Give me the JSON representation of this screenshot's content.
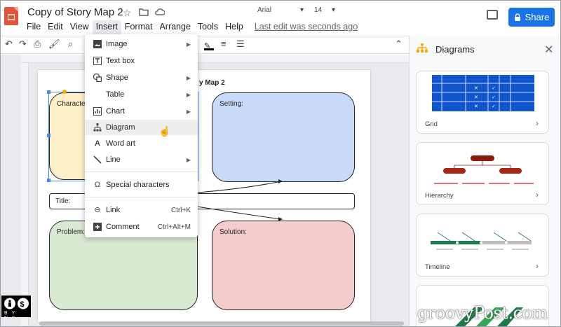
{
  "app": {
    "title": "Copy of Story Map 2",
    "last_edit": "Last edit was seconds ago",
    "share_label": "Share"
  },
  "menubar": [
    "File",
    "Edit",
    "View",
    "Insert",
    "Format",
    "Arrange",
    "Tools",
    "Help"
  ],
  "toolbar": {
    "font": "Arial",
    "size": "14"
  },
  "canvas": {
    "page_title": "y Map 2",
    "boxes": {
      "character": "Character",
      "setting": "Setting:",
      "title": "Title:",
      "problem": "Problem:",
      "solution": "Solution:"
    }
  },
  "insert_menu": {
    "items": [
      {
        "label": "Image",
        "icon": "image-icon",
        "submenu": true
      },
      {
        "label": "Text box",
        "icon": "text-box-icon"
      },
      {
        "label": "Shape",
        "icon": "shape-icon",
        "submenu": true
      },
      {
        "label": "Table",
        "icon": "",
        "submenu": true
      },
      {
        "label": "Chart",
        "icon": "chart-icon",
        "submenu": true
      },
      {
        "label": "Diagram",
        "icon": "diagram-icon",
        "highlighted": true
      },
      {
        "label": "Word art",
        "icon": "word-art-icon"
      },
      {
        "label": "Line",
        "icon": "line-icon",
        "submenu": true
      },
      {
        "label": "Special characters",
        "icon": "omega-icon"
      },
      {
        "label": "Link",
        "icon": "link-icon",
        "shortcut": "Ctrl+K"
      },
      {
        "label": "Comment",
        "icon": "comment-icon",
        "shortcut": "Ctrl+Alt+M"
      }
    ]
  },
  "panel": {
    "title": "Diagrams",
    "cards": [
      "Grid",
      "Hierarchy",
      "Timeline"
    ]
  },
  "watermark": "groovyPost.com",
  "license_badge": "BY NC",
  "colors": {
    "accent": "#1a73e8",
    "character_fill": "#fdefc8",
    "setting_fill": "#c9daf8",
    "problem_fill": "#d9ead3",
    "solution_fill": "#f4cccc",
    "diagram_dark": "#8b1a0e",
    "grid_blue": "#1155cc",
    "timeline_green": "#1e7b4a"
  }
}
